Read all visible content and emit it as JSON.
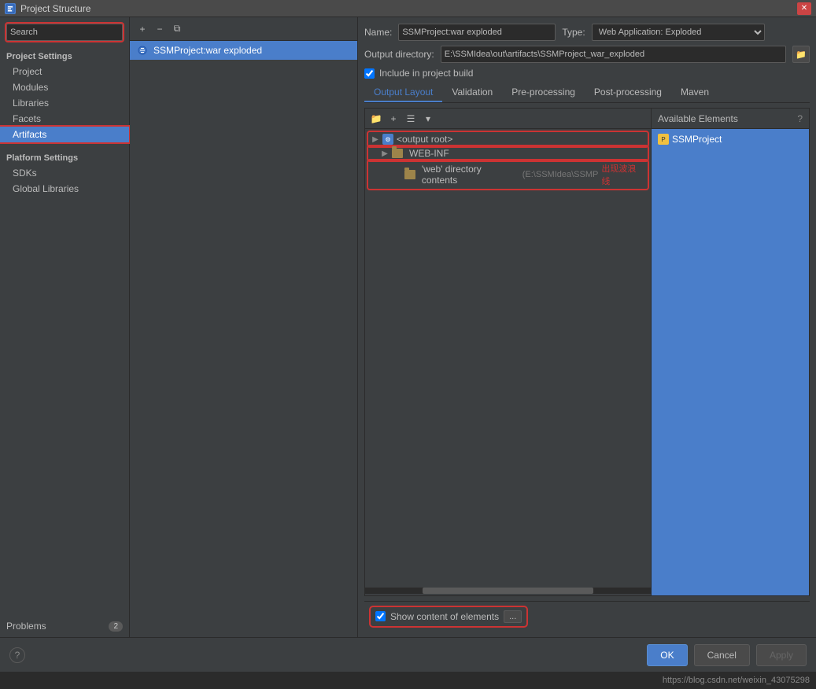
{
  "window": {
    "title": "Project Structure",
    "icon": "P"
  },
  "sidebar": {
    "search_placeholder": "Search",
    "project_settings_label": "Project Settings",
    "items": [
      {
        "id": "project",
        "label": "Project"
      },
      {
        "id": "modules",
        "label": "Modules"
      },
      {
        "id": "libraries",
        "label": "Libraries"
      },
      {
        "id": "facets",
        "label": "Facets"
      },
      {
        "id": "artifacts",
        "label": "Artifacts",
        "active": true
      }
    ],
    "platform_settings_label": "Platform Settings",
    "platform_items": [
      {
        "id": "sdks",
        "label": "SDKs"
      },
      {
        "id": "global-libraries",
        "label": "Global Libraries"
      }
    ],
    "problems_label": "Problems",
    "problems_count": "2"
  },
  "artifact_list": {
    "toolbar": {
      "add_tooltip": "+",
      "remove_tooltip": "−",
      "copy_tooltip": "⧉"
    },
    "items": [
      {
        "id": "ssm-war-exploded",
        "label": "SSMProject:war exploded",
        "selected": true
      }
    ]
  },
  "right_panel": {
    "name_label": "Name:",
    "name_value": "SSMProject:war exploded",
    "type_label": "Type:",
    "type_value": "Web Application: Exploded",
    "output_dir_label": "Output directory:",
    "output_dir_value": "E:\\SSMIdea\\out\\artifacts\\SSMProject_war_exploded",
    "include_in_build_label": "Include in project build",
    "include_in_build_checked": true,
    "tabs": [
      {
        "id": "output-layout",
        "label": "Output Layout",
        "active": true
      },
      {
        "id": "validation",
        "label": "Validation"
      },
      {
        "id": "pre-processing",
        "label": "Pre-processing"
      },
      {
        "id": "post-processing",
        "label": "Post-processing"
      },
      {
        "id": "maven",
        "label": "Maven"
      }
    ],
    "tree_items": [
      {
        "id": "output-root",
        "label": "<output root>",
        "level": 0,
        "type": "root"
      },
      {
        "id": "web-inf",
        "label": "WEB-INF",
        "level": 1,
        "type": "folder",
        "expanded": true
      },
      {
        "id": "web-dir",
        "label": "'web' directory contents",
        "level": 2,
        "type": "folder",
        "suffix": " (E:\\SSMIdea\\SSMP"
      }
    ],
    "wavy_text": "出现波浪线",
    "available_elements_label": "Available Elements",
    "available_items": [
      {
        "id": "ssm-project",
        "label": "SSMProject",
        "type": "project"
      }
    ],
    "show_content_label": "Show content of elements",
    "show_content_checked": true,
    "ellipsis_btn": "..."
  },
  "actions": {
    "ok_label": "OK",
    "cancel_label": "Cancel",
    "apply_label": "Apply"
  },
  "status_bar": {
    "url": "https://blog.csdn.net/weixin_43075298"
  }
}
